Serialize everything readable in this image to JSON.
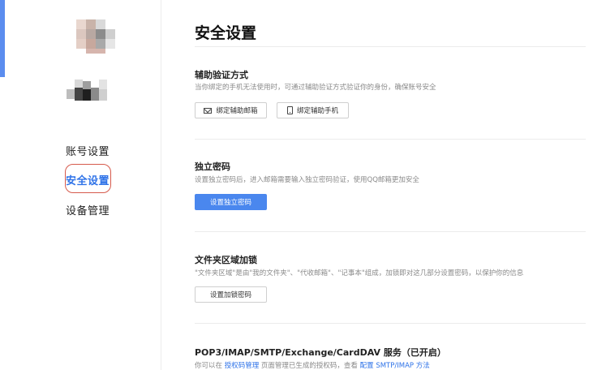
{
  "sidebar": {
    "items": [
      {
        "label": "账号设置"
      },
      {
        "label": "安全设置",
        "active": true
      },
      {
        "label": "设备管理"
      }
    ]
  },
  "page": {
    "title": "安全设置"
  },
  "sections": {
    "auth": {
      "title": "辅助验证方式",
      "desc": "当你绑定的手机无法使用时，可通过辅助验证方式验证你的身份，确保账号安全",
      "btn_email": "绑定辅助邮箱",
      "btn_phone": "绑定辅助手机"
    },
    "password": {
      "title": "独立密码",
      "desc": "设置独立密码后，进入邮箱需要输入独立密码验证，使用QQ邮箱更加安全",
      "btn": "设置独立密码"
    },
    "folder": {
      "title": "文件夹区域加锁",
      "desc": "\"文件夹区域\"是由\"我的文件夹\"、\"代收邮箱\"、\"记事本\"组成，加锁即对这几部分设置密码，以保护你的信息",
      "btn": "设置加锁密码"
    },
    "pop3": {
      "title": "POP3/IMAP/SMTP/Exchange/CardDAV 服务（已开启）",
      "desc_prefix": "你可以在 ",
      "link1": "授权码管理",
      "desc_mid": " 页面管理已生成的授权码，查看 ",
      "link2": "配置 SMTP/IMAP 方法"
    }
  },
  "colors": {
    "accent": "#2f73e8",
    "primary_button": "#4a87ee",
    "highlight_ring": "#d65a4c"
  }
}
